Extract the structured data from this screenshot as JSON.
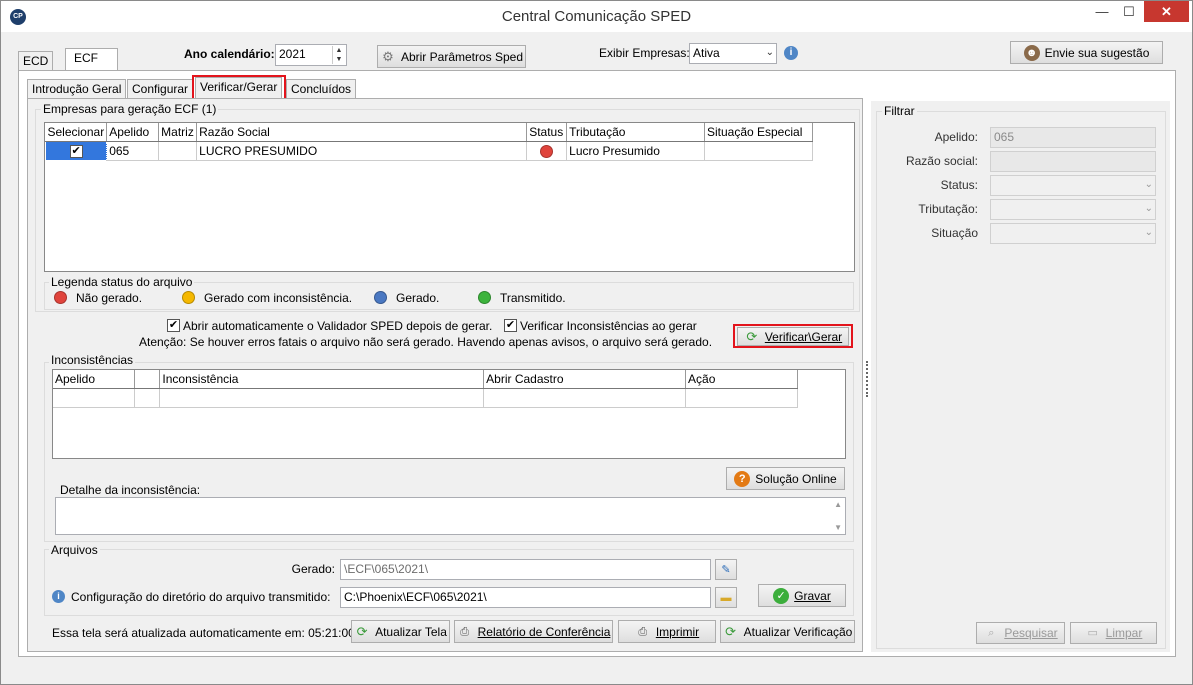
{
  "window": {
    "title": "Central Comunicação SPED",
    "app_icon": "CP",
    "minimize_icon": "minimize-icon",
    "maximize_icon": "maximize-icon",
    "close_icon": "close-icon"
  },
  "top_tabs": {
    "ecd": "ECD",
    "ecf": "ECF"
  },
  "toolbar": {
    "ano_label": "Ano calendário:",
    "ano_value": "2021",
    "abrir_parametros": "Abrir Parâmetros Sped",
    "exibir_label": "Exibir Empresas:",
    "exibir_value": "Ativa",
    "sugestao": "Envie sua sugestão"
  },
  "sub_tabs": {
    "intro": "Introdução Geral",
    "configurar": "Configurar",
    "verificar": "Verificar/Gerar",
    "concluidos": "Concluídos"
  },
  "empresas": {
    "title": "Empresas para geração ECF (1)",
    "columns": [
      "Selecionar",
      "Apelido",
      "Matriz",
      "Razão Social",
      "Status",
      "Tributação",
      "Situação Especial"
    ],
    "rows": [
      {
        "selecionar": "✔",
        "apelido": "065",
        "matriz": "",
        "razao": "LUCRO PRESUMIDO",
        "status_color": "#e0443c",
        "tributacao": "Lucro Presumido",
        "situacao": ""
      }
    ]
  },
  "legenda": {
    "title": "Legenda status do arquivo",
    "items": [
      {
        "label": "Não gerado.",
        "color": "#e0443c"
      },
      {
        "label": "Gerado com inconsistência.",
        "color": "#f5b800"
      },
      {
        "label": "Gerado.",
        "color": "#4a78c2"
      },
      {
        "label": "Transmitido.",
        "color": "#3cb33c"
      }
    ]
  },
  "opcoes": {
    "abrir_validador": "Abrir automaticamente o Validador SPED depois de gerar.",
    "verificar_inconsistencias": "Verificar Inconsistências ao gerar",
    "atencao": "Atenção: Se houver erros fatais o arquivo não será gerado. Havendo apenas avisos, o arquivo será gerado.",
    "verificar_gerar": "Verificar\\Gerar"
  },
  "inconsistencias": {
    "title": "Inconsistências",
    "columns": [
      "Apelido",
      "",
      "Inconsistência",
      "Abrir Cadastro",
      "Ação"
    ],
    "solucao_online": "Solução Online",
    "detalhe_label": "Detalhe da inconsistência:"
  },
  "arquivos": {
    "title": "Arquivos",
    "gerado_label": "Gerado:",
    "gerado_value": "\\ECF\\065\\2021\\",
    "config_label": "Configuração do diretório do arquivo transmitido:",
    "config_value": "C:\\Phoenix\\ECF\\065\\2021\\",
    "gravar": "Gravar"
  },
  "footer": {
    "atualizacao_text": "Essa tela será atualizada automaticamente em: 05:21:00",
    "atualizar_tela": "Atualizar Tela",
    "relatorio": "Relatório de Conferência",
    "imprimir": "Imprimir",
    "atualizar_verificacao": "Atualizar Verificação"
  },
  "filtrar": {
    "title": "Filtrar",
    "apelido_label": "Apelido:",
    "apelido_value": "065",
    "razao_label": "Razão social:",
    "status_label": "Status:",
    "tributacao_label": "Tributação:",
    "situacao_label": "Situação",
    "pesquisar": "Pesquisar",
    "limpar": "Limpar"
  },
  "colors": {
    "highlight": "#e3141c",
    "close_button": "#c7372f"
  }
}
